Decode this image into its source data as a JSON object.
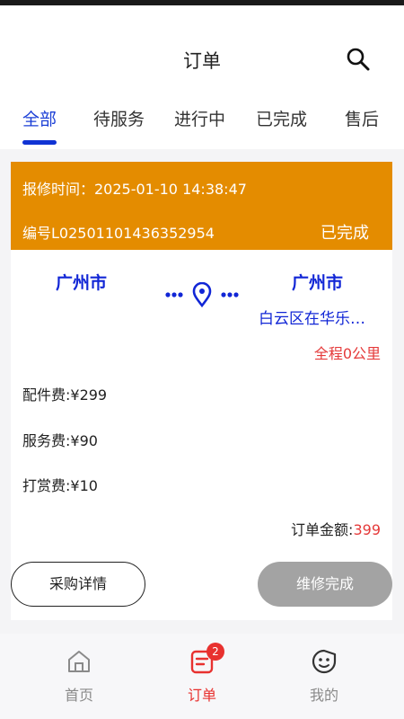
{
  "header": {
    "title": "订单"
  },
  "tabs": [
    {
      "label": "全部",
      "active": true
    },
    {
      "label": "待服务",
      "active": false
    },
    {
      "label": "进行中",
      "active": false
    },
    {
      "label": "已完成",
      "active": false
    },
    {
      "label": "售后",
      "active": false
    }
  ],
  "order": {
    "report_time": "报修时间：2025-01-10 14:38:47",
    "order_no": "编号L02501101436352954",
    "status": "已完成",
    "from_city": "广州市",
    "to_city": "广州市",
    "to_address": "白云区在华乐…",
    "distance": "全程0公里",
    "fees": {
      "parts": "配件费:¥299",
      "service": "服务费:¥90",
      "tip": "打赏费:¥10"
    },
    "total_label": "订单金额:",
    "total_amount": "399"
  },
  "actions": {
    "detail_label": "采购详情",
    "complete_label": "维修完成"
  },
  "tabbar": [
    {
      "label": "首页",
      "icon": "home-icon",
      "active": false
    },
    {
      "label": "订单",
      "icon": "order-icon",
      "active": true,
      "badge": "2"
    },
    {
      "label": "我的",
      "icon": "profile-face-icon",
      "active": false
    }
  ],
  "colors": {
    "accent_blue": "#1b3fd6",
    "header_orange": "#e48c00",
    "alert_red": "#e53a3a",
    "disabled_gray": "#a3a3a3"
  }
}
